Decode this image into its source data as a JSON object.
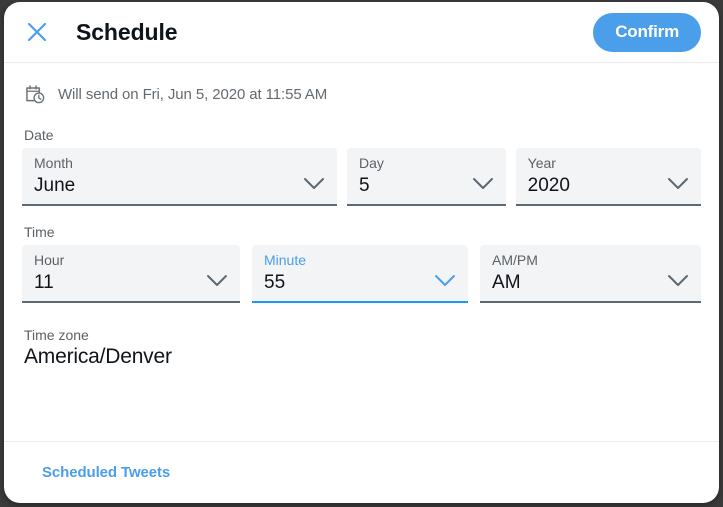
{
  "header": {
    "close_icon": "close-icon",
    "title": "Schedule",
    "confirm_label": "Confirm"
  },
  "will_send": {
    "icon": "calendar-clock-icon",
    "text": "Will send on Fri, Jun 5, 2020 at 11:55 AM"
  },
  "date_section": {
    "label": "Date",
    "fields": [
      {
        "label": "Month",
        "value": "June",
        "focused": false
      },
      {
        "label": "Day",
        "value": "5",
        "focused": false
      },
      {
        "label": "Year",
        "value": "2020",
        "focused": false
      }
    ]
  },
  "time_section": {
    "label": "Time",
    "fields": [
      {
        "label": "Hour",
        "value": "11",
        "focused": false
      },
      {
        "label": "Minute",
        "value": "55",
        "focused": true
      },
      {
        "label": "AM/PM",
        "value": "AM",
        "focused": false
      }
    ]
  },
  "timezone": {
    "label": "Time zone",
    "value": "America/Denver"
  },
  "footer": {
    "link_label": "Scheduled Tweets"
  },
  "colors": {
    "accent": "#4a9eea",
    "focus": "#1d9bf0",
    "text_primary": "#0f1419",
    "text_secondary": "#5b6267",
    "field_bg": "#f3f4f6",
    "field_underline": "#5b6975"
  }
}
